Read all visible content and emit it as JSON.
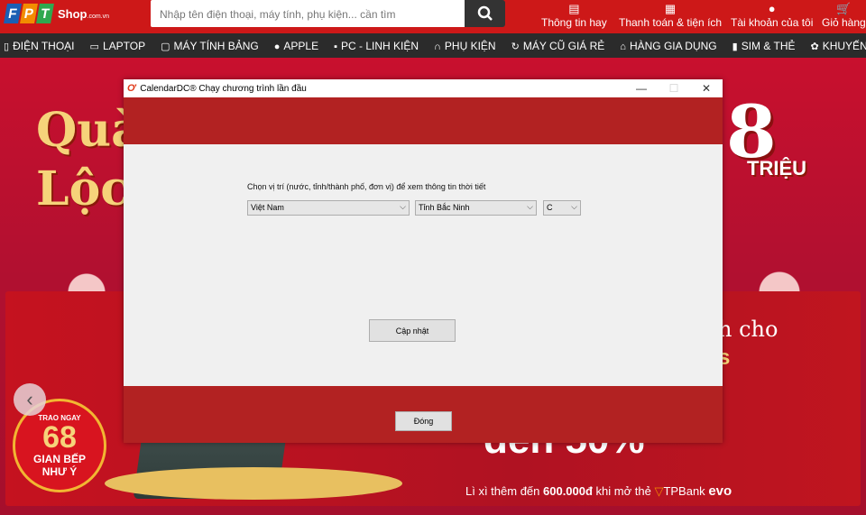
{
  "header": {
    "logo_letters": [
      "F",
      "P",
      "T"
    ],
    "logo_colors": [
      "#1a5fb4",
      "#f28c00",
      "#2fa84f"
    ],
    "logo_shop": "Shop",
    "logo_domain": ".com.vn",
    "search_placeholder": "Nhập tên điện thoại, máy tính, phụ kiện... cần tìm",
    "links": [
      {
        "label": "Thông tin hay",
        "icon": "document-icon"
      },
      {
        "label": "Thanh toán & tiện ích",
        "icon": "bill-icon"
      },
      {
        "label": "Tài khoản của tôi",
        "icon": "user-icon"
      },
      {
        "label": "Giỏ hàng",
        "icon": "cart-icon"
      }
    ]
  },
  "nav": [
    {
      "label": "ĐIỆN THOẠI",
      "icon": "phone-icon"
    },
    {
      "label": "LAPTOP",
      "icon": "laptop-icon"
    },
    {
      "label": "MÁY TÍNH BẢNG",
      "icon": "tablet-icon"
    },
    {
      "label": "APPLE",
      "icon": "apple-icon"
    },
    {
      "label": "PC - LINH KIỆN",
      "icon": "pc-icon"
    },
    {
      "label": "PHỤ KIỆN",
      "icon": "headphones-icon"
    },
    {
      "label": "MÁY CŨ GIÁ RẺ",
      "icon": "refresh-icon"
    },
    {
      "label": "HÀNG GIA DỤNG",
      "icon": "home-icon"
    },
    {
      "label": "SIM & THẺ",
      "icon": "sim-icon"
    },
    {
      "label": "KHUYẾN MÃI",
      "icon": "gift-icon"
    }
  ],
  "hero": {
    "left_text_1": "Quà",
    "left_text_2": "Lộc",
    "right_amount": "8",
    "right_unit": "TRIỆU",
    "banner_badge": {
      "top": "TRAO NGAY",
      "num": "68",
      "line1": "GIAN BẾP",
      "line2": "NHƯ Ý"
    },
    "banner_right_1": "h cho",
    "banner_right_2": "s",
    "banner_percent": "đến 50%",
    "promo_prefix": "Lì xì thêm đến ",
    "promo_amount": "600.000đ",
    "promo_suffix": " khi mở thẻ ",
    "promo_bank": "TPBank",
    "promo_card": "evo"
  },
  "dialog": {
    "title": "CalendarDC® Chạy chương trình lần đầu",
    "accent": "#b22222",
    "prompt": "Chọn vị trí (nước, tỉnh/thành phố, đơn vị) để xem thông tin thời tiết",
    "country": "Việt Nam",
    "province": "Tỉnh Bắc Ninh",
    "unit": "C",
    "update_label": "Cập nhật",
    "close_label": "Đóng"
  }
}
